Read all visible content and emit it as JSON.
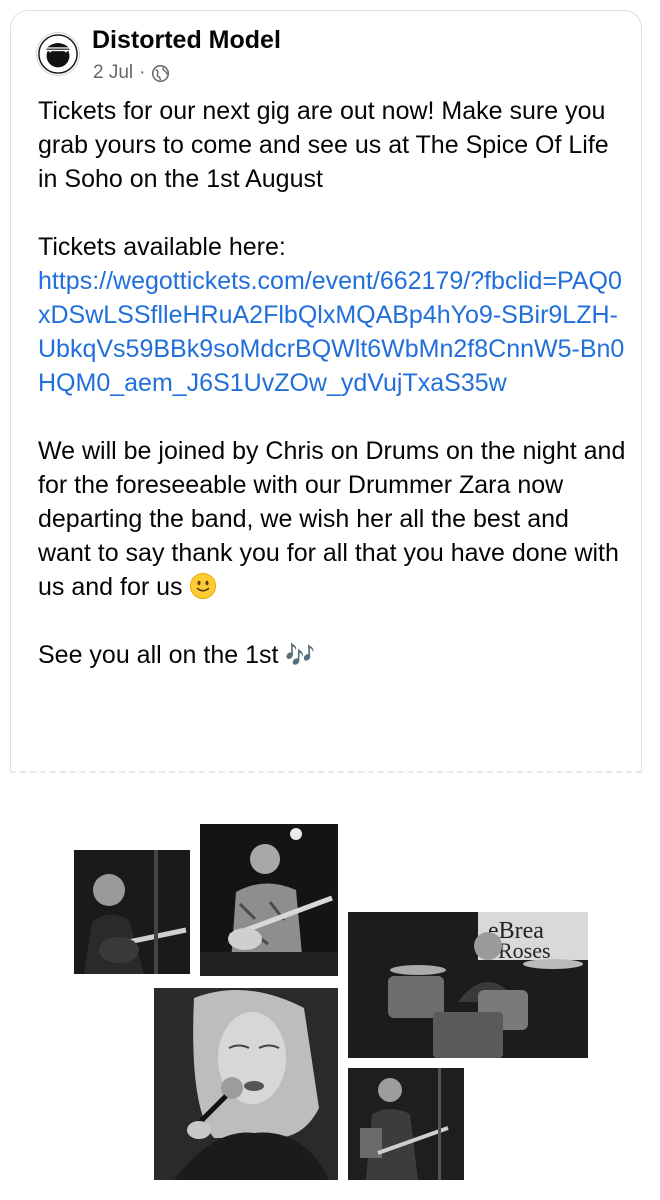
{
  "post": {
    "page_name": "Distorted Model",
    "date": "2 Jul",
    "separator": "·",
    "paragraph1": "Tickets for our next gig are out now! Make sure you grab yours to come and see us at The Spice Of Life in Soho on the 1st August",
    "tickets_label": "Tickets available here:",
    "link_text": "https://wegottickets.com/event/662179/?fbclid=PAQ0xDSwLSSflleHRuA2FlbQlxMQABp4hYo9-SBir9LZH-UbkqVs59BBk9soMdcrBQWlt6WbMn2f8CnnW5-Bn0HQM0_aem_J6S1UvZOw_ydVujTxaS35w",
    "paragraph3": "We will be joined by Chris on Drums on the night and for the foreseeable with our Drummer Zara now departing the band, we wish her all the best and want to say thank you for all that you have done with us and for us",
    "paragraph4": "See you all on the 1st",
    "notes_emoji": "🎶",
    "icons": {
      "privacy": "globe-icon",
      "emoji": "slightly-smiling-face-icon"
    }
  },
  "colors": {
    "link": "#216fdb",
    "meta": "#65676b",
    "text": "#050505"
  }
}
